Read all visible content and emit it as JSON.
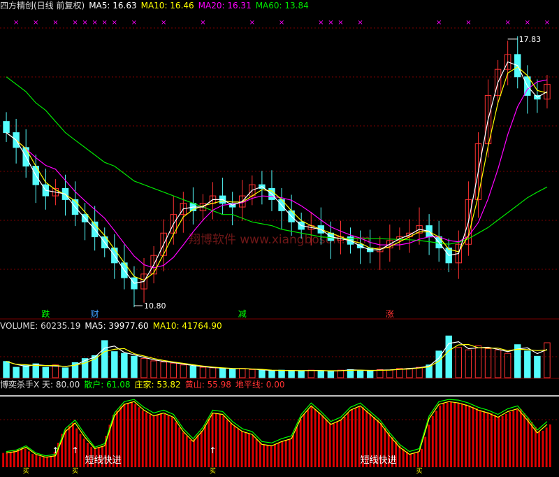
{
  "price_header": {
    "title": "四方精创(日线 前复权)",
    "ma5": "MA5: 16.63",
    "ma10": "MA10: 16.46",
    "ma20": "MA20: 16.31",
    "ma60": "MA60: 13.84"
  },
  "volume_header": {
    "volume": "VOLUME: 60235.19",
    "ma5": "MA5: 39977.60",
    "ma10": "MA10: 41764.90"
  },
  "indicator_header": {
    "name": "博奕杀手X 天: 80.00",
    "retail": "散户: 61.08",
    "dealer": "庄家: 53.82",
    "yellow_mountain": "黄山: 55.98",
    "horizon": "地平线: 0.00"
  },
  "annotations": {
    "high": "17.83",
    "low": "10.80",
    "signals": [
      "跌",
      "财",
      "减",
      "涨"
    ],
    "short_term": "短线快进",
    "buy_marker": "买"
  },
  "watermark": "翔博软件 www.xiangbosoft.com",
  "colors": {
    "up": "#ff3232",
    "down": "#54fcfc",
    "ma5": "#ffffff",
    "ma10": "#ffff00",
    "ma20": "#ff00ff",
    "ma60": "#00e600",
    "indicator_green": "#00ff00"
  },
  "chart_data": [
    {
      "type": "candlestick",
      "ylim": [
        10.5,
        18.3
      ],
      "sampled": true,
      "close": [
        15.3,
        14.9,
        14.4,
        13.9,
        13.6,
        13.8,
        13.5,
        13.1,
        12.9,
        12.5,
        12.2,
        11.8,
        11.4,
        11.1,
        11.5,
        12.0,
        12.6,
        13.1,
        13.4,
        13.2,
        13.4,
        13.6,
        13.4,
        13.3,
        13.6,
        13.9,
        13.8,
        13.5,
        13.2,
        12.9,
        12.7,
        12.8,
        12.6,
        12.4,
        12.5,
        12.3,
        12.2,
        12.1,
        12.2,
        12.4,
        12.5,
        12.6,
        12.8,
        12.5,
        12.2,
        11.8,
        12.3,
        13.5,
        15.0,
        16.3,
        17.0,
        17.4,
        16.8,
        16.3,
        16.2,
        16.6
      ],
      "ma60": [
        16.8,
        16.6,
        16.4,
        16.1,
        15.9,
        15.6,
        15.3,
        15.1,
        14.9,
        14.7,
        14.5,
        14.4,
        14.2,
        14.0,
        13.9,
        13.8,
        13.7,
        13.6,
        13.5,
        13.4,
        13.3,
        13.2,
        13.1,
        13.1,
        13.0,
        12.9,
        12.85,
        12.8,
        12.7,
        12.65,
        12.6,
        12.55,
        12.5,
        12.48,
        12.45,
        12.45,
        12.45,
        12.45,
        12.45,
        12.44,
        12.43,
        12.42,
        12.4,
        12.37,
        12.33,
        12.3,
        12.35,
        12.45,
        12.6,
        12.75,
        12.95,
        13.15,
        13.35,
        13.55,
        13.7,
        13.84
      ]
    },
    {
      "type": "bar",
      "title": "VOLUME",
      "ylim": [
        0,
        82000
      ],
      "sampled": true,
      "values": [
        28000,
        18000,
        21000,
        24000,
        18000,
        22000,
        17000,
        26000,
        33000,
        38000,
        64000,
        45000,
        42000,
        37000,
        33000,
        29000,
        27000,
        25000,
        22000,
        20000,
        18000,
        17000,
        16000,
        15000,
        16000,
        14000,
        13000,
        12000,
        13000,
        12000,
        12000,
        13000,
        12000,
        11000,
        13000,
        14000,
        12000,
        12000,
        14000,
        13000,
        16000,
        16000,
        18000,
        22000,
        46000,
        72000,
        52000,
        48000,
        55000,
        50000,
        48000,
        42000,
        57000,
        46000,
        37000,
        60235
      ]
    },
    {
      "type": "area",
      "title": "博奕杀手X",
      "ylim": [
        0,
        100
      ],
      "sampled": true,
      "series": [
        {
          "name": "庄家",
          "values": [
            20,
            22,
            28,
            18,
            14,
            16,
            50,
            62,
            42,
            26,
            30,
            72,
            88,
            92,
            80,
            72,
            76,
            70,
            50,
            36,
            52,
            76,
            74,
            60,
            50,
            46,
            32,
            30,
            36,
            40,
            70,
            86,
            74,
            60,
            66,
            80,
            86,
            74,
            62,
            44,
            28,
            18,
            22,
            68,
            88,
            92,
            90,
            86,
            80,
            76,
            70,
            78,
            82,
            66,
            48,
            60
          ]
        },
        {
          "name": "散户",
          "values": [
            22,
            24,
            30,
            20,
            16,
            18,
            54,
            66,
            46,
            28,
            33,
            76,
            92,
            95,
            84,
            76,
            80,
            74,
            54,
            40,
            56,
            80,
            78,
            64,
            54,
            50,
            36,
            34,
            40,
            44,
            74,
            90,
            78,
            64,
            70,
            84,
            90,
            78,
            66,
            48,
            32,
            22,
            26,
            72,
            92,
            95,
            94,
            90,
            84,
            80,
            74,
            82,
            86,
            70,
            52,
            64
          ]
        }
      ]
    }
  ]
}
